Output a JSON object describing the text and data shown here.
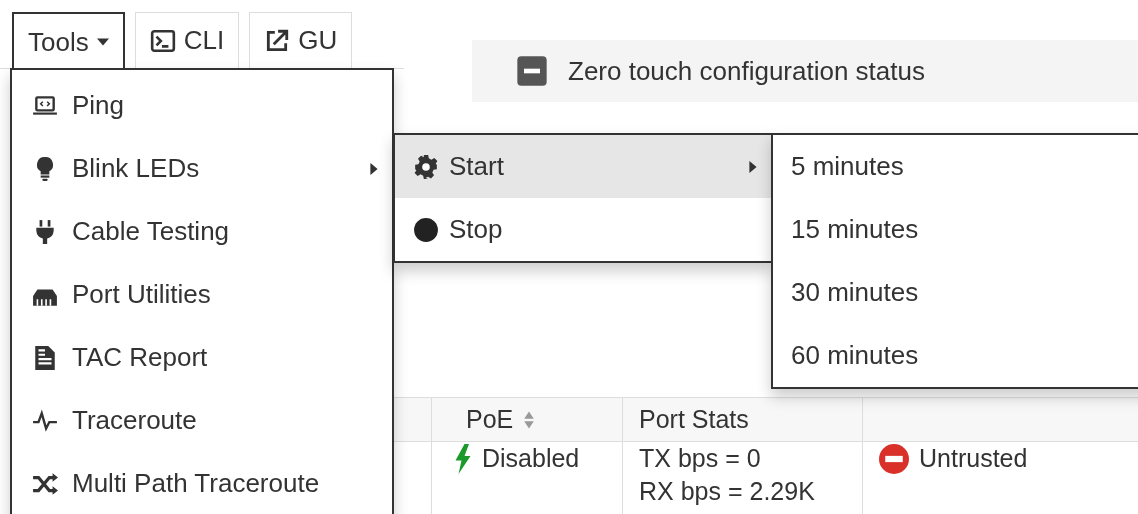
{
  "toolbar": [
    {
      "label": "Tools",
      "kind": "dropdown",
      "selected": true
    },
    {
      "label": "CLI",
      "kind": "cli",
      "selected": false
    },
    {
      "label": "GU",
      "kind": "external",
      "selected": false
    }
  ],
  "status_panel": {
    "title": "Zero touch configuration status",
    "expanded": true
  },
  "table": {
    "columns": [
      {
        "label": "PoE",
        "sortable": true
      },
      {
        "label": "Port Stats",
        "sortable": false
      }
    ],
    "rows": [
      {
        "poe": "Disabled",
        "port_stats": [
          "TX bps = 0",
          "RX bps = 2.29K"
        ],
        "trust": "Untrusted"
      }
    ]
  },
  "tools_menu": [
    {
      "label": "Ping",
      "kind": "laptop",
      "submenu": false
    },
    {
      "label": "Blink LEDs",
      "kind": "bulb",
      "submenu": true
    },
    {
      "label": "Cable Testing",
      "kind": "plug",
      "submenu": false
    },
    {
      "label": "Port Utilities",
      "kind": "port",
      "submenu": false
    },
    {
      "label": "TAC Report",
      "kind": "report",
      "submenu": false
    },
    {
      "label": "Traceroute",
      "kind": "pulse",
      "submenu": false
    },
    {
      "label": "Multi Path Traceroute",
      "kind": "shuffle",
      "submenu": false
    }
  ],
  "blink_menu": [
    {
      "label": "Start",
      "kind": "gear",
      "submenu": true,
      "selected": true
    },
    {
      "label": "Stop",
      "kind": "circle",
      "submenu": false,
      "selected": false
    }
  ],
  "duration_menu": [
    "5 minutes",
    "15 minutes",
    "30 minutes",
    "60 minutes"
  ]
}
